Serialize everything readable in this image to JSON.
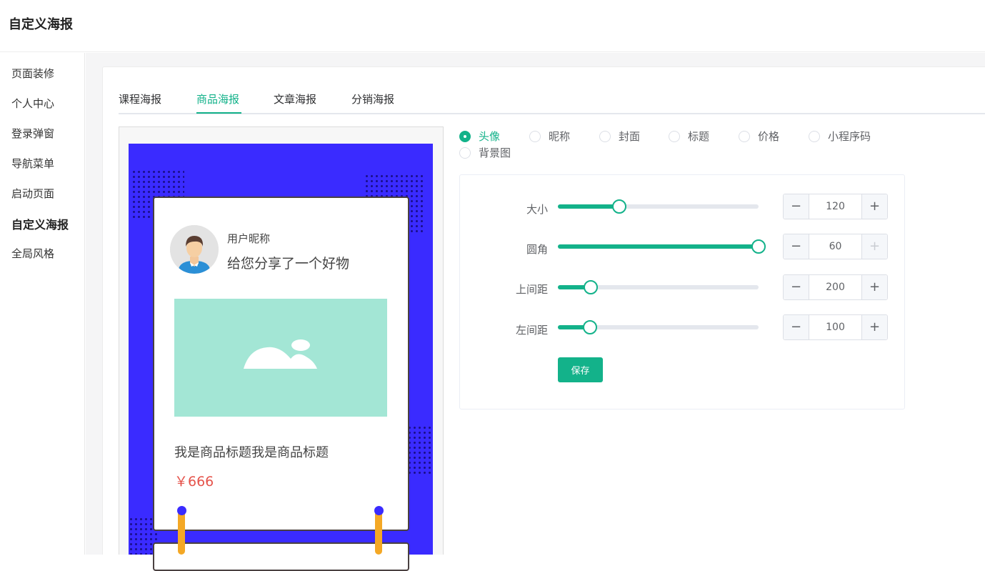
{
  "header": {
    "title": "自定义海报"
  },
  "sidebar": {
    "items": [
      {
        "label": "页面装修"
      },
      {
        "label": "个人中心"
      },
      {
        "label": "登录弹窗"
      },
      {
        "label": "导航菜单"
      },
      {
        "label": "启动页面"
      },
      {
        "label": "自定义海报",
        "active": true
      },
      {
        "label": "全局风格"
      }
    ]
  },
  "tabs": [
    {
      "label": "课程海报"
    },
    {
      "label": "商品海报",
      "active": true
    },
    {
      "label": "文章海报"
    },
    {
      "label": "分销海报"
    }
  ],
  "poster": {
    "nickname": "用户昵称",
    "share_text": "给您分享了一个好物",
    "goods_title": "我是商品标题我是商品标题",
    "price": "￥666",
    "background_color": "#3a2bff"
  },
  "elements": {
    "selected": "头像",
    "options": [
      {
        "label": "头像"
      },
      {
        "label": "昵称"
      },
      {
        "label": "封面"
      },
      {
        "label": "标题"
      },
      {
        "label": "价格"
      },
      {
        "label": "小程序码"
      },
      {
        "label": "背景图"
      }
    ]
  },
  "settings": {
    "rows": [
      {
        "label": "大小",
        "value": "120",
        "slider_fraction": 0.307
      },
      {
        "label": "圆角",
        "value": "60",
        "slider_fraction": 1.0,
        "plus_disabled": true
      },
      {
        "label": "上间距",
        "value": "200",
        "slider_fraction": 0.163
      },
      {
        "label": "左间距",
        "value": "100",
        "slider_fraction": 0.16
      }
    ],
    "save_label": "保存"
  },
  "accent_color": "#13b28a"
}
